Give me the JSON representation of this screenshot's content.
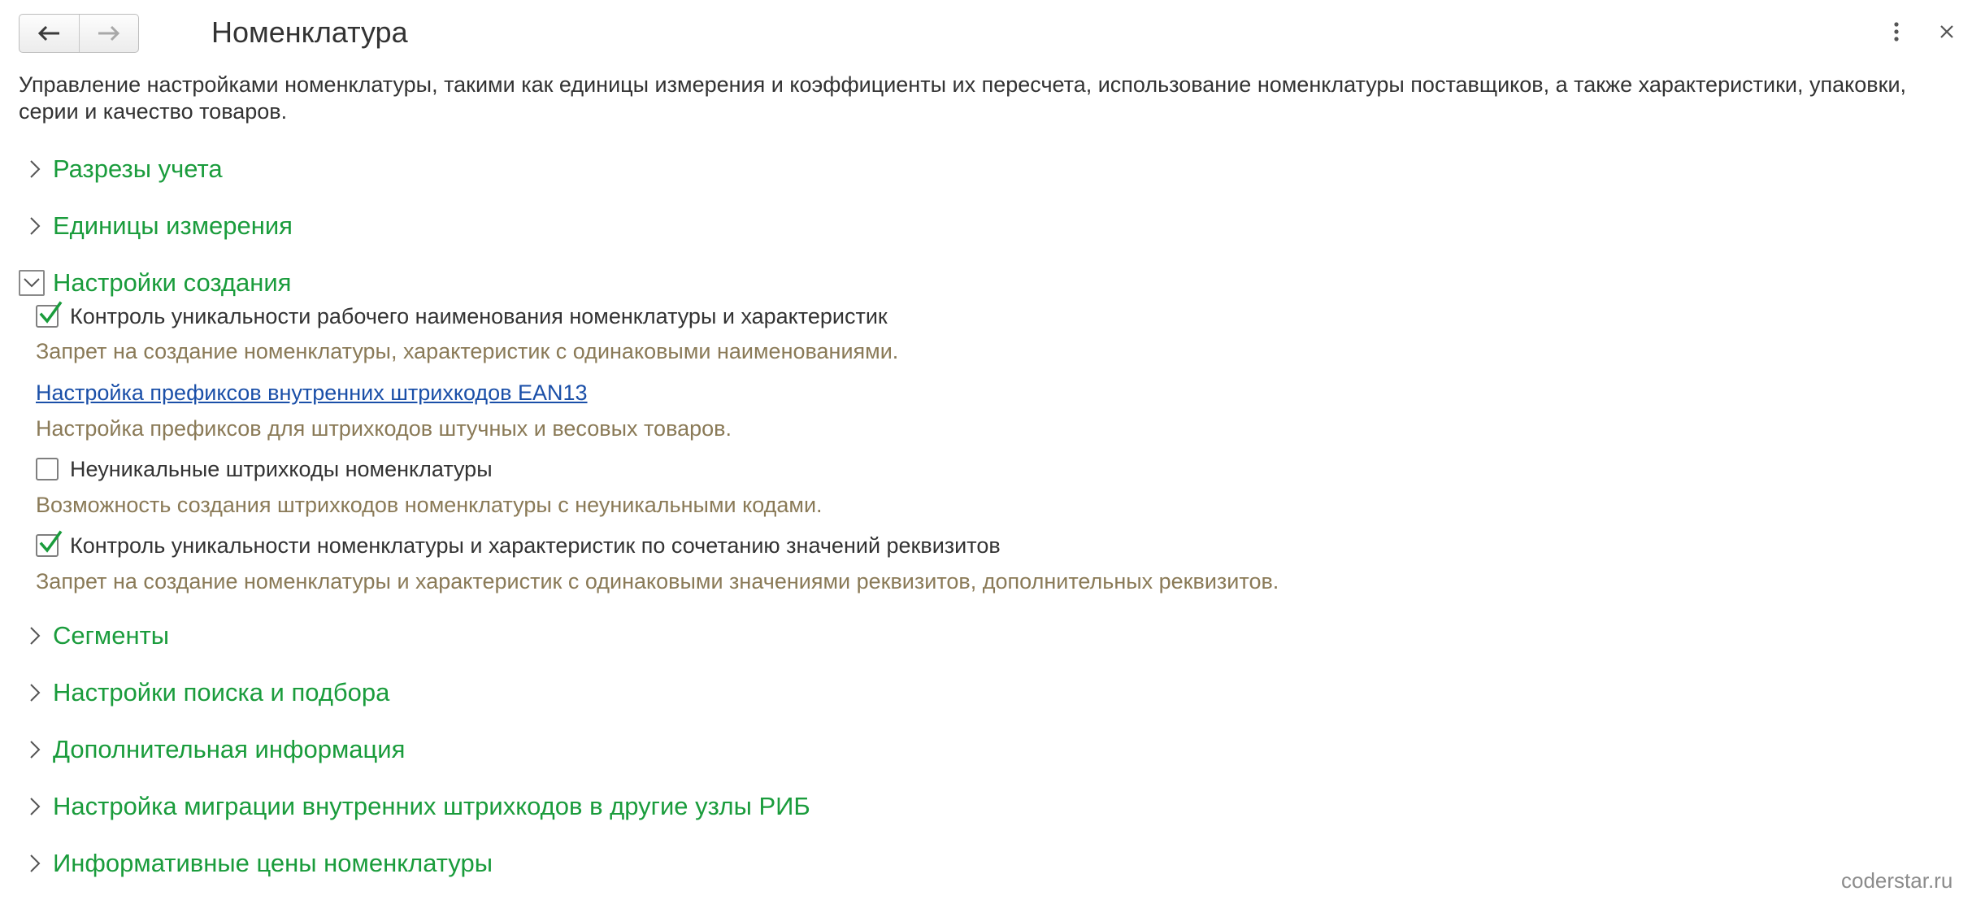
{
  "header": {
    "title": "Номенклатура",
    "back_icon": "arrow-left-icon",
    "forward_icon": "arrow-right-icon",
    "more_icon": "more-vertical-icon",
    "close_icon": "close-icon"
  },
  "description": "Управление настройками номенклатуры, такими как единицы измерения и коэффициенты их пересчета, использование номенклатуры поставщиков, а также характеристики, упаковки, серии и качество товаров.",
  "colors": {
    "section_title": "#1a9c3c",
    "hint_text": "#8a7a57",
    "link": "#1a4fa8",
    "checkmark": "#1a9c3c"
  },
  "sections": [
    {
      "title": "Разрезы учета",
      "expanded": false
    },
    {
      "title": "Единицы измерения",
      "expanded": false
    },
    {
      "title": "Настройки создания",
      "expanded": true,
      "items": [
        {
          "type": "checkbox",
          "checked": true,
          "label": "Контроль уникальности рабочего наименования номенклатуры и характеристик",
          "hint": "Запрет на создание номенклатуры, характеристик с одинаковыми наименованиями."
        },
        {
          "type": "link",
          "label": "Настройка префиксов внутренних штрихкодов EAN13",
          "hint": "Настройка префиксов для штрихкодов штучных и весовых товаров."
        },
        {
          "type": "checkbox",
          "checked": false,
          "label": "Неуникальные штрихкоды номенклатуры",
          "hint": "Возможность создания штрихкодов номенклатуры с неуникальными кодами."
        },
        {
          "type": "checkbox",
          "checked": true,
          "label": "Контроль уникальности номенклатуры и характеристик по сочетанию значений реквизитов",
          "hint": "Запрет на создание номенклатуры и характеристик с одинаковыми значениями реквизитов, дополнительных реквизитов."
        }
      ]
    },
    {
      "title": "Сегменты",
      "expanded": false
    },
    {
      "title": "Настройки поиска и подбора",
      "expanded": false
    },
    {
      "title": "Дополнительная информация",
      "expanded": false
    },
    {
      "title": "Настройка миграции внутренних штрихкодов в другие узлы РИБ",
      "expanded": false
    },
    {
      "title": "Информативные цены номенклатуры",
      "expanded": false
    }
  ],
  "watermark": "coderstar.ru"
}
